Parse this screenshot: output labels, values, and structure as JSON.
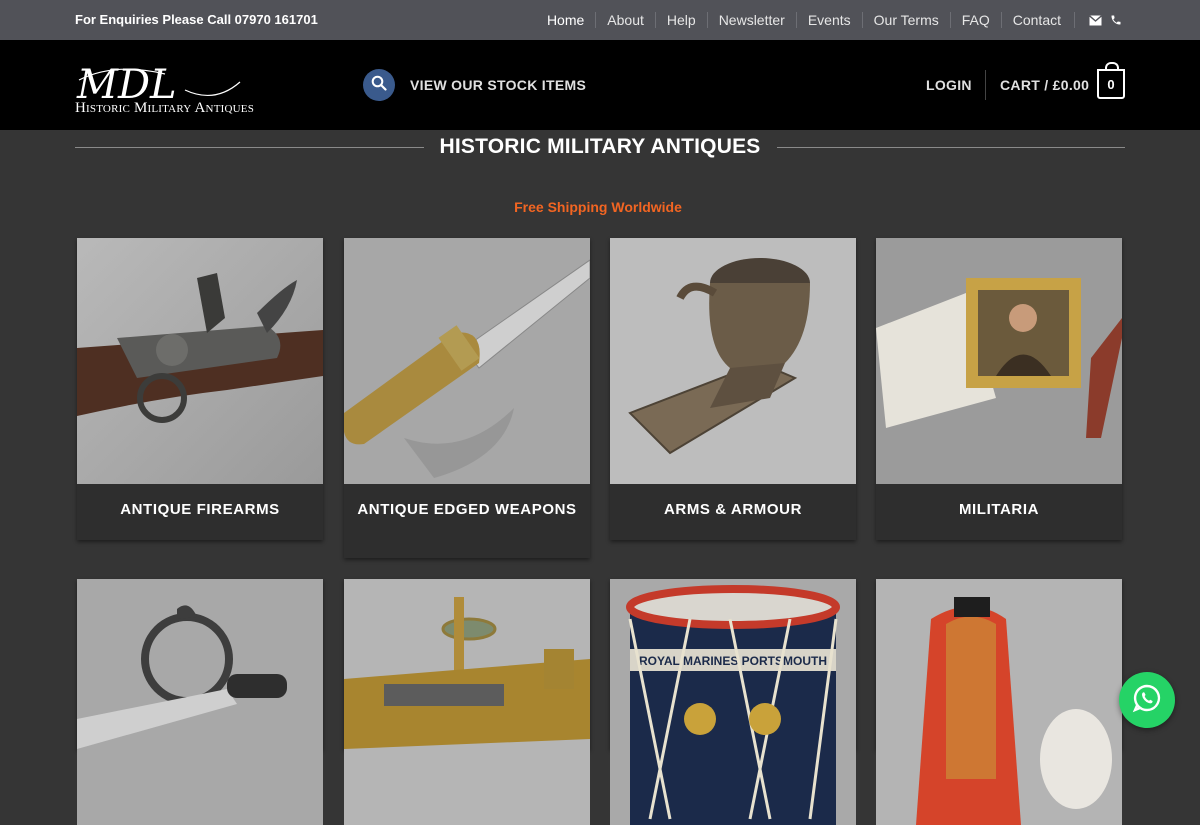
{
  "topbar": {
    "enquiry": "For Enquiries Please Call 07970 161701",
    "nav": [
      "Home",
      "About",
      "Help",
      "Newsletter",
      "Events",
      "Our Terms",
      "FAQ",
      "Contact"
    ],
    "icons": [
      "envelope-icon",
      "phone-icon"
    ]
  },
  "header": {
    "logo_monogram": "MDL",
    "logo_text": "Historic Military Antiques",
    "stock_link": "VIEW OUR STOCK ITEMS",
    "login": "LOGIN",
    "cart_label": "CART / £0.00",
    "cart_count": "0"
  },
  "main": {
    "title": "HISTORIC MILITARY ANTIQUES",
    "shipping": "Free Shipping Worldwide",
    "categories": [
      {
        "label": "ANTIQUE FIREARMS",
        "image": "flintlock rifle"
      },
      {
        "label": "ANTIQUE EDGED WEAPONS",
        "image": "brass-hilted blade"
      },
      {
        "label": "ARMS & ARMOUR",
        "image": "bronze mortar"
      },
      {
        "label": "MILITARIA",
        "image": "portrait and documents"
      },
      {
        "label": "",
        "image": "basket-hilted sword"
      },
      {
        "label": "",
        "image": "brass instrument"
      },
      {
        "label": "",
        "image": "Royal Marine drum"
      },
      {
        "label": "",
        "image": "red dress uniform"
      }
    ],
    "drum_text": "ROYAL MARINES PORTSMOUTH"
  },
  "colors": {
    "topbar": "#515258",
    "header": "#000000",
    "background": "#353535",
    "accent": "#f26522",
    "search_button": "#3a5a8c",
    "whatsapp": "#25d366"
  }
}
